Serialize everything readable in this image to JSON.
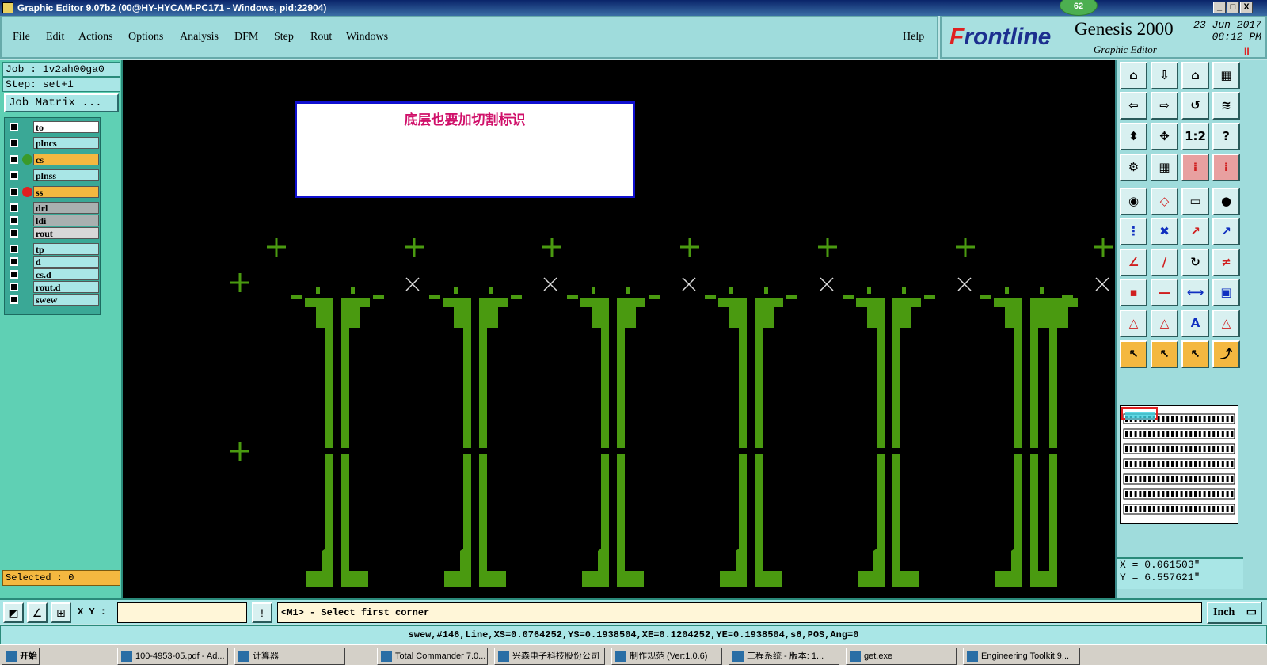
{
  "window": {
    "title": "Graphic Editor 9.07b2 (00@HY-HYCAM-PC171 - Windows, pid:22904)",
    "badge": "62",
    "controls": [
      "_",
      "□",
      "X"
    ]
  },
  "menu": {
    "items": [
      "File",
      "Edit",
      "Actions",
      "Options",
      "Analysis",
      "DFM",
      "Step",
      "Rout",
      "Windows"
    ],
    "help": "Help"
  },
  "brand": {
    "logo_pre": "F",
    "logo_post": "rontline",
    "product": "Genesis 2000",
    "subtitle": "Graphic Editor",
    "date": "23 Jun 2017",
    "time": "08:12 PM",
    "pause": "II"
  },
  "left": {
    "job": "Job : 1v2ah00ga0",
    "step": "Step: set+1",
    "job_matrix": "Job Matrix ...",
    "layers": [
      {
        "name": "to",
        "bg": "#ffffff",
        "dot": ""
      },
      {
        "name": "plncs",
        "bg": "#a9e6e6",
        "dot": ""
      },
      {
        "name": "cs",
        "bg": "#f4b840",
        "dot": "#3a9a2a"
      },
      {
        "name": "plnss",
        "bg": "#a9e6e6",
        "dot": ""
      },
      {
        "name": "ss",
        "bg": "#f4b840",
        "dot": "#e02020"
      },
      {
        "name": "drl",
        "bg": "#a9b0b0",
        "dot": ""
      },
      {
        "name": "ldi",
        "bg": "#a9b0b0",
        "dot": ""
      },
      {
        "name": "rout",
        "bg": "#d8d8d8",
        "dot": ""
      },
      {
        "name": "tp",
        "bg": "#a9e6e6",
        "dot": ""
      },
      {
        "name": "d",
        "bg": "#a9e6e6",
        "dot": ""
      },
      {
        "name": "cs.d",
        "bg": "#a9e6e6",
        "dot": ""
      },
      {
        "name": "rout.d",
        "bg": "#a9e6e6",
        "dot": ""
      },
      {
        "name": "swew",
        "bg": "#a9e6e6",
        "dot": ""
      }
    ],
    "selected": "Selected : 0"
  },
  "canvas": {
    "note": "底层也要加切割标识",
    "feature_color": "#4a9a10"
  },
  "right": {
    "tools": [
      "⌂",
      "⇩",
      "⌂",
      "▦",
      "⇦",
      "⇨",
      "↺",
      "≋",
      "⬍",
      "✥",
      "1:2",
      "?",
      "⚙",
      "▦",
      "⁞",
      "⁞",
      "◉",
      "◇",
      "▭",
      "●",
      "⋮",
      "✖",
      "↗",
      "↗",
      "∠",
      "/",
      "↻",
      "≠",
      "▪",
      "—",
      "⟷",
      "▣",
      "△",
      "△",
      "A",
      "△",
      "↖",
      "↖",
      "↖",
      "⤴"
    ],
    "x_coord": "X = 0.061503\"",
    "y_coord": "Y = 6.557621\""
  },
  "command": {
    "xy_label": "X Y :",
    "xy_value": "",
    "prompt": "<M1> - Select first corner",
    "unit": "Inch"
  },
  "status": "swew,#146,Line,XS=0.0764252,YS=0.1938504,XE=0.1204252,YE=0.1938504,s6,POS,Ang=0",
  "taskbar": {
    "start": "开始",
    "tasks": [
      "100-4953-05.pdf - Ad...",
      "计算器",
      "Total Commander 7.0...",
      "兴森电子科技股份公司",
      "制作规范 (Ver:1.0.6)",
      "工程系统 - 版本: 1...",
      "get.exe",
      "Engineering Toolkit 9..."
    ]
  }
}
